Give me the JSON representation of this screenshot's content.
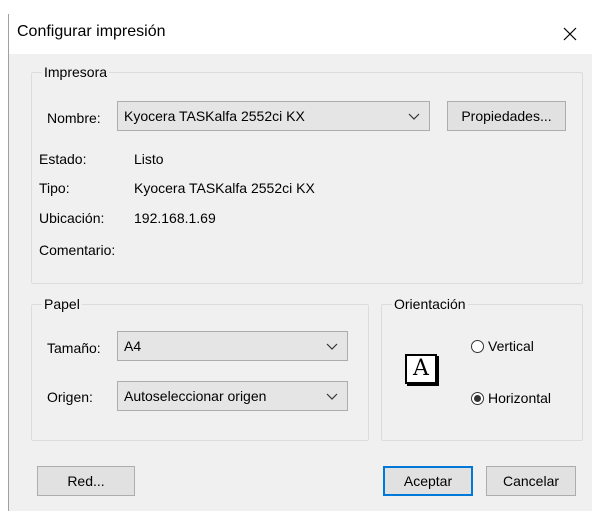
{
  "window": {
    "title": "Configurar impresión",
    "close_glyph": "✕"
  },
  "printer": {
    "group_label": "Impresora",
    "name_label": "Nombre:",
    "name_value": "Kyocera TASKalfa 2552ci KX",
    "properties_button": "Propiedades...",
    "status_label": "Estado:",
    "status_value": "Listo",
    "type_label": "Tipo:",
    "type_value": "Kyocera TASKalfa 2552ci KX",
    "location_label": "Ubicación:",
    "location_value": "192.168.1.69",
    "comment_label": "Comentario:",
    "comment_value": ""
  },
  "paper": {
    "group_label": "Papel",
    "size_label": "Tamaño:",
    "size_value": "A4",
    "source_label": "Origen:",
    "source_value": "Autoseleccionar origen"
  },
  "orientation": {
    "group_label": "Orientación",
    "icon_letter": "A",
    "options": [
      {
        "label": "Vertical",
        "checked": false
      },
      {
        "label": "Horizontal",
        "checked": true
      }
    ]
  },
  "footer": {
    "network_button": "Red...",
    "ok_button": "Aceptar",
    "cancel_button": "Cancelar"
  },
  "colors": {
    "accent": "#0078d7",
    "dialog_bg": "#f0f0f0",
    "button_bg": "#e1e1e1"
  }
}
